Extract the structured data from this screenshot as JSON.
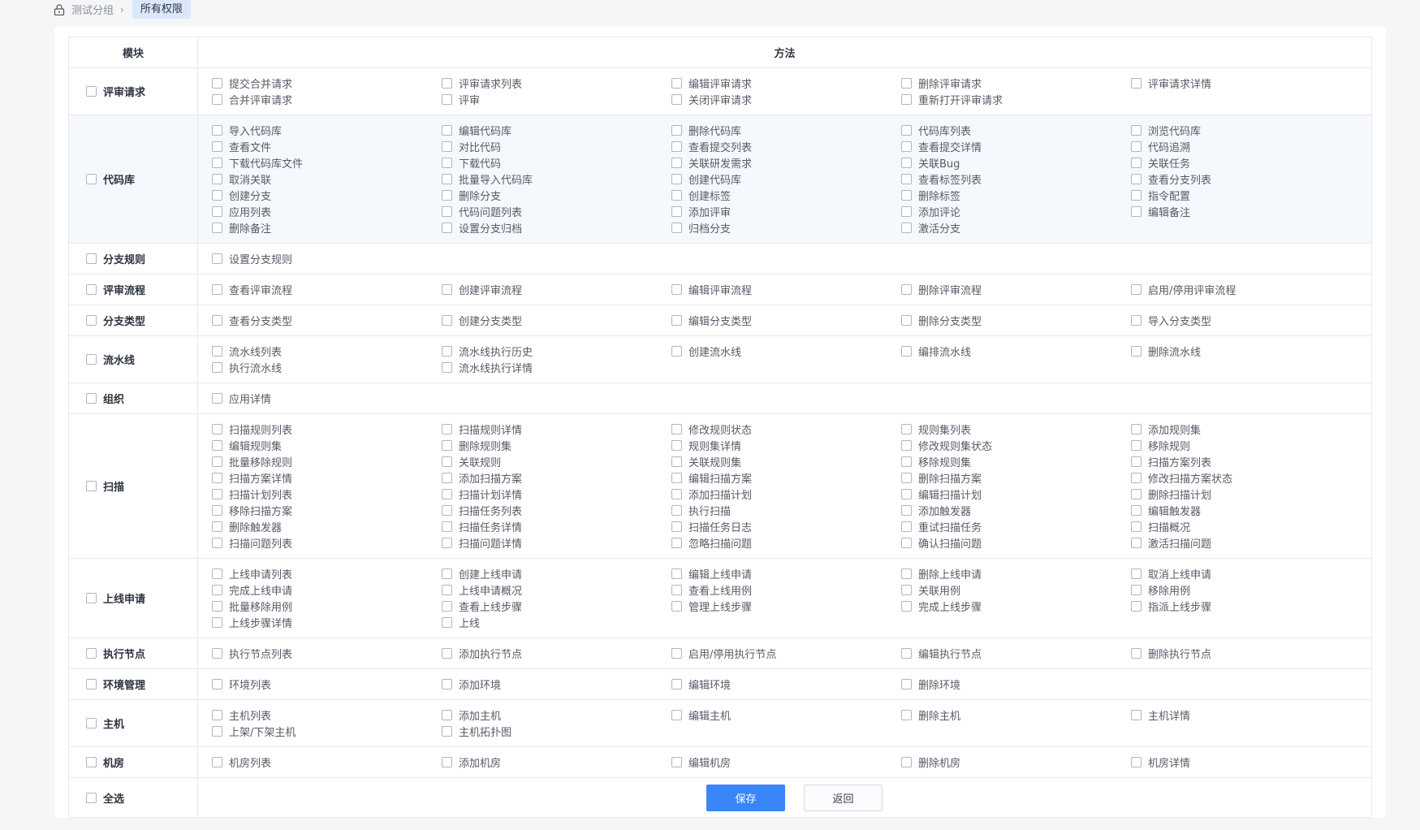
{
  "breadcrumb": {
    "parent": "测试分组",
    "separator": "›",
    "current": "所有权限"
  },
  "table": {
    "header_module": "模块",
    "header_methods": "方法"
  },
  "modules": [
    {
      "name": "评审请求",
      "items": [
        "提交合并请求",
        "评审请求列表",
        "编辑评审请求",
        "删除评审请求",
        "评审请求详情",
        "合并评审请求",
        "评审",
        "关闭评审请求",
        "重新打开评审请求"
      ]
    },
    {
      "name": "代码库",
      "highlighted": true,
      "items": [
        "导入代码库",
        "编辑代码库",
        "删除代码库",
        "代码库列表",
        "浏览代码库",
        "查看文件",
        "对比代码",
        "查看提交列表",
        "查看提交详情",
        "代码追溯",
        "下载代码库文件",
        "下载代码",
        "关联研发需求",
        "关联Bug",
        "关联任务",
        "取消关联",
        "批量导入代码库",
        "创建代码库",
        "查看标签列表",
        "查看分支列表",
        "创建分支",
        "删除分支",
        "创建标签",
        "删除标签",
        "指令配置",
        "应用列表",
        "代码问题列表",
        "添加评审",
        "添加评论",
        "编辑备注",
        "删除备注",
        "设置分支归档",
        "归档分支",
        "激活分支"
      ]
    },
    {
      "name": "分支规则",
      "items": [
        "设置分支规则"
      ]
    },
    {
      "name": "评审流程",
      "items": [
        "查看评审流程",
        "创建评审流程",
        "编辑评审流程",
        "删除评审流程",
        "启用/停用评审流程"
      ]
    },
    {
      "name": "分支类型",
      "items": [
        "查看分支类型",
        "创建分支类型",
        "编辑分支类型",
        "删除分支类型",
        "导入分支类型"
      ]
    },
    {
      "name": "流水线",
      "items": [
        "流水线列表",
        "流水线执行历史",
        "创建流水线",
        "编排流水线",
        "删除流水线",
        "执行流水线",
        "流水线执行详情"
      ]
    },
    {
      "name": "组织",
      "items": [
        "应用详情"
      ]
    },
    {
      "name": "扫描",
      "items": [
        "扫描规则列表",
        "扫描规则详情",
        "修改规则状态",
        "规则集列表",
        "添加规则集",
        "编辑规则集",
        "删除规则集",
        "规则集详情",
        "修改规则集状态",
        "移除规则",
        "批量移除规则",
        "关联规则",
        "关联规则集",
        "移除规则集",
        "扫描方案列表",
        "扫描方案详情",
        "添加扫描方案",
        "编辑扫描方案",
        "删除扫描方案",
        "修改扫描方案状态",
        "扫描计划列表",
        "扫描计划详情",
        "添加扫描计划",
        "编辑扫描计划",
        "删除扫描计划",
        "移除扫描方案",
        "扫描任务列表",
        "执行扫描",
        "添加触发器",
        "编辑触发器",
        "删除触发器",
        "扫描任务详情",
        "扫描任务日志",
        "重试扫描任务",
        "扫描概况",
        "扫描问题列表",
        "扫描问题详情",
        "忽略扫描问题",
        "确认扫描问题",
        "激活扫描问题"
      ]
    },
    {
      "name": "上线申请",
      "items": [
        "上线申请列表",
        "创建上线申请",
        "编辑上线申请",
        "删除上线申请",
        "取消上线申请",
        "完成上线申请",
        "上线申请概况",
        "查看上线用例",
        "关联用例",
        "移除用例",
        "批量移除用例",
        "查看上线步骤",
        "管理上线步骤",
        "完成上线步骤",
        "指派上线步骤",
        "上线步骤详情",
        "上线"
      ]
    },
    {
      "name": "执行节点",
      "items": [
        "执行节点列表",
        "添加执行节点",
        "启用/停用执行节点",
        "编辑执行节点",
        "删除执行节点"
      ]
    },
    {
      "name": "环境管理",
      "items": [
        "环境列表",
        "添加环境",
        "编辑环境",
        "删除环境"
      ]
    },
    {
      "name": "主机",
      "items": [
        "主机列表",
        "添加主机",
        "编辑主机",
        "删除主机",
        "主机详情",
        "上架/下架主机",
        "主机拓扑图"
      ]
    },
    {
      "name": "机房",
      "items": [
        "机房列表",
        "添加机房",
        "编辑机房",
        "删除机房",
        "机房详情"
      ]
    }
  ],
  "footer": {
    "select_all": "全选",
    "save": "保存",
    "back": "返回"
  },
  "colors": {
    "primary": "#3a86f8",
    "highlight_row": "#f5f8fd",
    "active_crumb": "#dbe8fb"
  }
}
